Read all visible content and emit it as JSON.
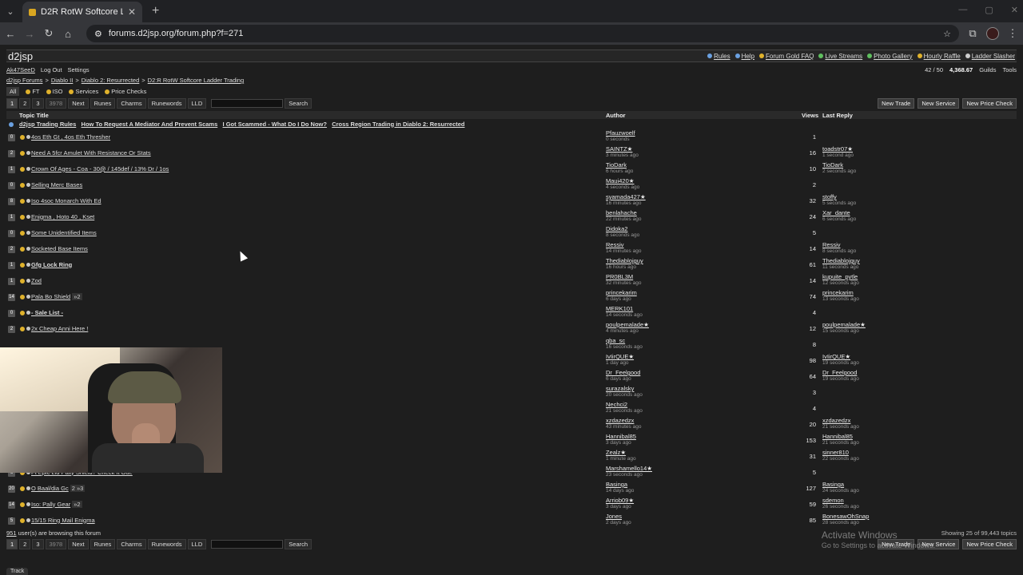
{
  "browser": {
    "tab_title": "D2R RotW Softcore Ladder Tra",
    "url": "forums.d2jsp.org/forum.php?f=271"
  },
  "site": {
    "logo": "d2jsp",
    "top_links": [
      "Rules",
      "Help",
      "Forum Gold FAQ",
      "Live Streams",
      "Photo Gallery",
      "Hourly Raffle",
      "Ladder Slasher"
    ],
    "user": "Ak47SeeD",
    "logout": "Log Out",
    "settings": "Settings",
    "inbox": "42 / 50",
    "gold": "4,368.67",
    "guilds": "Guilds",
    "tools": "Tools"
  },
  "breadcrumbs": [
    "d2jsp Forums",
    "Diablo II",
    "Diablo 2: Resurrected",
    "D2:R RotW Softcore Ladder Trading"
  ],
  "filters": [
    "All",
    "FT",
    "ISO",
    "Services",
    "Price Checks"
  ],
  "pager": {
    "pages": [
      "1",
      "2",
      "3"
    ],
    "total": "3978",
    "next": "Next",
    "links": [
      "Runes",
      "Charms",
      "Runewords",
      "LLD"
    ],
    "search": "Search",
    "actions": [
      "New Trade",
      "New Service",
      "New Price Check"
    ]
  },
  "columns": {
    "title": "Topic Title",
    "author": "Author",
    "views": "Views",
    "last": "Last Reply"
  },
  "sticky": [
    "d2jsp Trading Rules",
    "How To Request A Mediator And Prevent Scams",
    "I Got Scammed - What Do I Do Now?",
    "Cross Region Trading in Diablo 2: Resurrected"
  ],
  "topics": [
    {
      "c": "0",
      "t": "4os Eth Gt , 4os Eth Thresher",
      "a": "Pfauzwoelf",
      "at": "0 seconds",
      "v": "1",
      "l": "",
      "lt": "",
      "bold": false
    },
    {
      "c": "2",
      "t": "Need A 5fcr Amulet With Resistance Or Stats",
      "a": "SAINTZ★",
      "at": "3 minutes ago",
      "v": "16",
      "l": "toadstr07★",
      "lt": "1 second ago",
      "bold": false
    },
    {
      "c": "1",
      "t": "Crown Of Ages - Coa - 30@ / 145def / 13% Dr / 1os",
      "a": "TioDark",
      "at": "6 hours ago",
      "v": "10",
      "l": "TioDark",
      "lt": "2 seconds ago",
      "bold": false
    },
    {
      "c": "0",
      "t": "Selling Merc Bases",
      "a": "Maui420★",
      "at": "4 seconds ago",
      "v": "2",
      "l": "",
      "lt": "",
      "bold": false
    },
    {
      "c": "8",
      "t": "Iso 4soc Monarch With Ed",
      "a": "syamada427★",
      "at": "16 minutes ago",
      "v": "32",
      "l": "stoffy",
      "lt": "5 seconds ago",
      "bold": false
    },
    {
      "c": "1",
      "t": "Enigma , Hoto 40 , Kset",
      "a": "benlahache",
      "at": "22 minutes ago",
      "v": "24",
      "l": "Xar_dante",
      "lt": "6 seconds ago",
      "bold": false
    },
    {
      "c": "0",
      "t": "Some Unidentified Items",
      "a": "Didoka2",
      "at": "8 seconds ago",
      "v": "5",
      "l": "",
      "lt": "",
      "bold": false
    },
    {
      "c": "2",
      "t": "Socketed Base Items",
      "a": "Ressiv",
      "at": "14 minutes ago",
      "v": "14",
      "l": "Ressiv",
      "lt": "8 seconds ago",
      "bold": false
    },
    {
      "c": "1",
      "t": "Gfg Lock Ring",
      "a": "Thediablojguy",
      "at": "16 hours ago",
      "v": "61",
      "l": "Thediablojguy",
      "lt": "11 seconds ago",
      "bold": true
    },
    {
      "c": "1",
      "t": "Zod",
      "a": "PR0BL3M",
      "at": "32 minutes ago",
      "v": "14",
      "l": "kupuite_pytle",
      "lt": "12 seconds ago",
      "bold": false
    },
    {
      "c": "14",
      "t": "Pala Bo Shield",
      "a": "princekarim",
      "at": "6 days ago",
      "v": "74",
      "l": "princekarim",
      "lt": "13 seconds ago",
      "bold": false,
      "chip": "»2"
    },
    {
      "c": "0",
      "t": "- Sale List -",
      "a": "MERK101",
      "at": "14 seconds ago",
      "v": "4",
      "l": "",
      "lt": "",
      "bold": true
    },
    {
      "c": "2",
      "t": "2x Cheap Anni Here !",
      "a": "poulpemalade★",
      "at": "4 minutes ago",
      "v": "12",
      "l": "poulpemalade★",
      "lt": "15 seconds ago",
      "bold": false
    },
    {
      "c": "",
      "t": "",
      "a": "qba_sc",
      "at": "16 seconds ago",
      "v": "8",
      "l": "",
      "lt": "",
      "bold": false
    },
    {
      "c": "",
      "t": "",
      "a": "IvIirQUE★",
      "at": "1 day ago",
      "v": "98",
      "l": "IvIirQUE★",
      "lt": "19 seconds ago",
      "bold": false
    },
    {
      "c": "",
      "t": "",
      "a": "Dr_Feelgood",
      "at": "6 days ago",
      "v": "64",
      "l": "Dr_Feelgood",
      "lt": "19 seconds ago",
      "bold": false
    },
    {
      "c": "",
      "t": "",
      "a": "surazalsky",
      "at": "20 seconds ago",
      "v": "3",
      "l": "",
      "lt": "",
      "bold": false
    },
    {
      "c": "",
      "t": "",
      "a": "Nechci2",
      "at": "21 seconds ago",
      "v": "4",
      "l": "",
      "lt": "",
      "bold": false
    },
    {
      "c": "",
      "t": "",
      "a": "xzdazedzx",
      "at": "43 minutes ago",
      "v": "20",
      "l": "xzdazedzx",
      "lt": "21 seconds ago",
      "bold": false
    },
    {
      "c": "",
      "t": "",
      "a": "Hannibal85",
      "at": "3 days ago",
      "v": "153",
      "l": "Hannibal85",
      "lt": "21 seconds ago",
      "bold": false
    },
    {
      "c": "",
      "t": "",
      "a": "Zealz★",
      "at": "1 minute ago",
      "v": "31",
      "l": "sinner810",
      "lt": "22 seconds ago",
      "bold": false
    },
    {
      "c": "6",
      "t": "Ft Epic Lld Pally Shield? Check It Out.",
      "a": "Marshamello14★",
      "at": "23 seconds ago",
      "v": "5",
      "l": "",
      "lt": "",
      "bold": false
    },
    {
      "c": "20",
      "t": "O Baal/dia Gc",
      "a": "Basinga",
      "at": "14 days ago",
      "v": "127",
      "l": "Basinga",
      "lt": "24 seconds ago",
      "bold": false,
      "chip": "2 »3"
    },
    {
      "c": "14",
      "t": "Iso: Pally Gear",
      "a": "Arriob09★",
      "at": "3 days ago",
      "v": "59",
      "l": "sdemon",
      "lt": "26 seconds ago",
      "bold": false,
      "chip": "»2"
    },
    {
      "c": "5",
      "t": "15/15 Ring Mail Enigma",
      "a": "Jones",
      "at": "2 days ago",
      "v": "85",
      "l": "BonesawOhSnap",
      "lt": "28 seconds ago",
      "bold": false
    }
  ],
  "footer": {
    "browsing_count": "951",
    "browsing_text": "user(s) are browsing this forum",
    "showing": "Showing 25 of 99,443 topics",
    "track": "Track"
  },
  "watermark": {
    "line1": "Activate Windows",
    "line2": "Go to Settings to activate Windows."
  }
}
